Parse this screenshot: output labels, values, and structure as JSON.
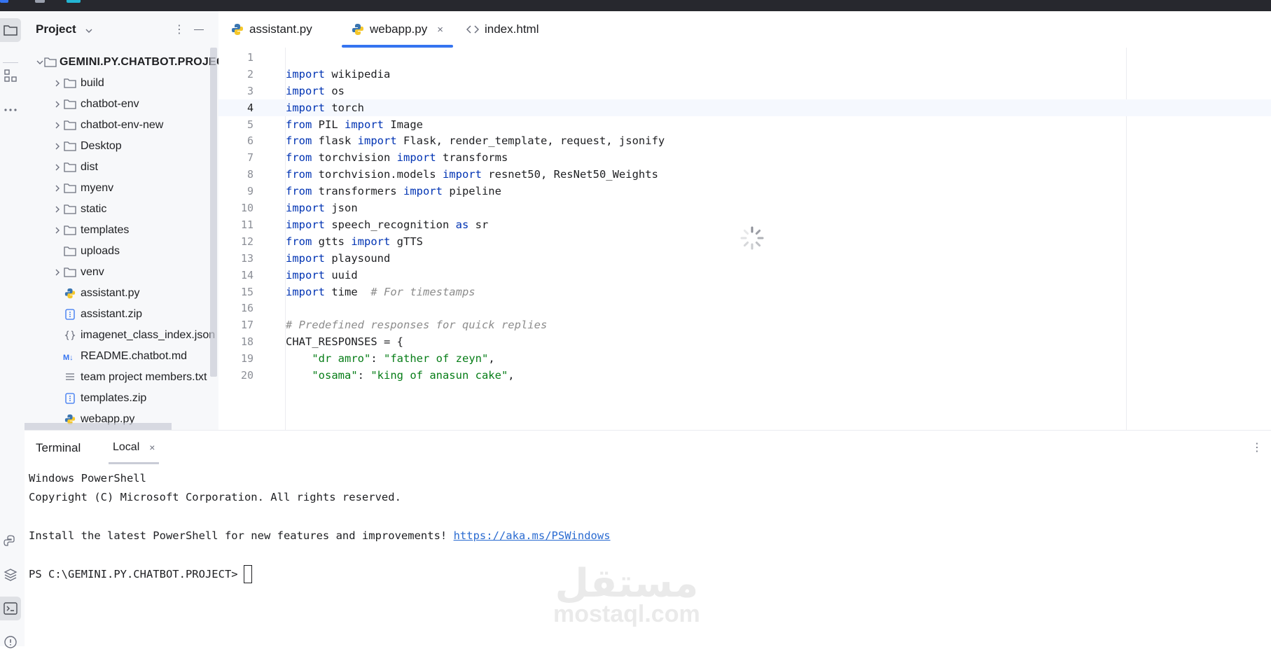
{
  "project_panel": {
    "title": "Project",
    "root": "GEMINI.PY.CHATBOT.PROJECT",
    "items": [
      {
        "label": "build",
        "type": "folder",
        "expandable": true
      },
      {
        "label": "chatbot-env",
        "type": "folder",
        "expandable": true
      },
      {
        "label": "chatbot-env-new",
        "type": "folder",
        "expandable": true
      },
      {
        "label": "Desktop",
        "type": "folder",
        "expandable": true
      },
      {
        "label": "dist",
        "type": "folder",
        "expandable": true
      },
      {
        "label": "myenv",
        "type": "folder",
        "expandable": true
      },
      {
        "label": "static",
        "type": "folder",
        "expandable": true
      },
      {
        "label": "templates",
        "type": "folder",
        "expandable": true
      },
      {
        "label": "uploads",
        "type": "folder",
        "expandable": false
      },
      {
        "label": "venv",
        "type": "folder",
        "expandable": true
      },
      {
        "label": "assistant.py",
        "type": "python-file",
        "expandable": false
      },
      {
        "label": "assistant.zip",
        "type": "zip-file",
        "expandable": false
      },
      {
        "label": "imagenet_class_index.json",
        "type": "json-file",
        "expandable": false
      },
      {
        "label": "README.chatbot.md",
        "type": "markdown-file",
        "expandable": false
      },
      {
        "label": "team project members.txt",
        "type": "text-file",
        "expandable": false
      },
      {
        "label": "templates.zip",
        "type": "zip-file",
        "expandable": false
      },
      {
        "label": "webapp.py",
        "type": "python-file",
        "expandable": false
      }
    ]
  },
  "tabs": [
    {
      "label": "assistant.py",
      "icon": "python-icon",
      "active": false
    },
    {
      "label": "webapp.py",
      "icon": "python-icon",
      "active": true,
      "close": "×"
    },
    {
      "label": "index.html",
      "icon": "html-icon",
      "active": false
    }
  ],
  "editor": {
    "current_line": 4,
    "lines": [
      {
        "n": "1",
        "code": ""
      },
      {
        "n": "2",
        "code": "import wikipedia"
      },
      {
        "n": "3",
        "code": "import os"
      },
      {
        "n": "4",
        "code": "import torch"
      },
      {
        "n": "5",
        "code": "from PIL import Image"
      },
      {
        "n": "6",
        "code": "from flask import Flask, render_template, request, jsonify"
      },
      {
        "n": "7",
        "code": "from torchvision import transforms"
      },
      {
        "n": "8",
        "code": "from torchvision.models import resnet50, ResNet50_Weights"
      },
      {
        "n": "9",
        "code": "from transformers import pipeline"
      },
      {
        "n": "10",
        "code": "import json"
      },
      {
        "n": "11",
        "code": "import speech_recognition as sr"
      },
      {
        "n": "12",
        "code": "from gtts import gTTS"
      },
      {
        "n": "13",
        "code": "import playsound"
      },
      {
        "n": "14",
        "code": "import uuid"
      },
      {
        "n": "15",
        "code": "import time  # For timestamps"
      },
      {
        "n": "16",
        "code": ""
      },
      {
        "n": "17",
        "code": "# Predefined responses for quick replies"
      },
      {
        "n": "18",
        "code": "CHAT_RESPONSES = {"
      },
      {
        "n": "19",
        "code": "    \"dr amro\": \"father of zeyn\","
      },
      {
        "n": "20",
        "code": "    \"osama\": \"king of anasun cake\","
      }
    ]
  },
  "terminal": {
    "title": "Terminal",
    "tab_label": "Local",
    "tab_close": "×",
    "lines": [
      "Windows PowerShell",
      "Copyright (C) Microsoft Corporation. All rights reserved.",
      "",
      "Install the latest PowerShell for new features and improvements! "
    ],
    "link": "https://aka.ms/PSWindows",
    "prompt": "PS C:\\GEMINI.PY.CHATBOT.PROJECT>"
  },
  "watermark": {
    "arabic": "مستقل",
    "latin": "mostaql.com"
  },
  "colors": {
    "accent": "#3574f0",
    "keyword": "#0033b3",
    "string": "#067d17",
    "comment": "#8c8c8c",
    "link": "#2a6bd1"
  }
}
